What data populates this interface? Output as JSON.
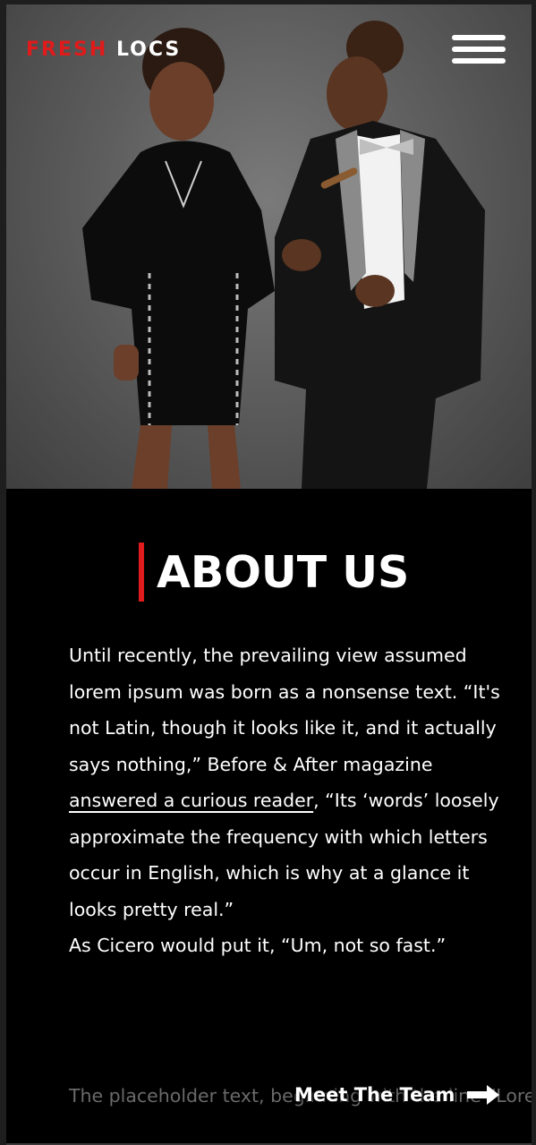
{
  "header": {
    "logo_accent": "FRESH",
    "logo_rest": "LOCS",
    "menu_icon": "hamburger-menu-icon"
  },
  "colors": {
    "accent": "#e01b1b",
    "background": "#000000",
    "text": "#ffffff",
    "muted_text": "#6a6a6a"
  },
  "about": {
    "title": "ABOUT US",
    "paragraph_part1": "Until recently, the prevailing view assumed lorem ipsum was born as a nonsense text. “It's not Latin, though it looks like it, and it actually says nothing,” Before & After magazine ",
    "link_text": "answered a curious reader",
    "paragraph_part2": ", “Its ‘words’ loosely approximate the frequency with which letters occur in English, which is why at a glance it looks pretty real.”",
    "paragraph2": "As Cicero would put it, “Um, not so fast.”",
    "placeholder_text": "The placeholder text, beginning with the line “Lorem ipsum dolor sit amet,"
  },
  "cta": {
    "label": "Meet The Team",
    "icon": "arrow-right-icon"
  }
}
